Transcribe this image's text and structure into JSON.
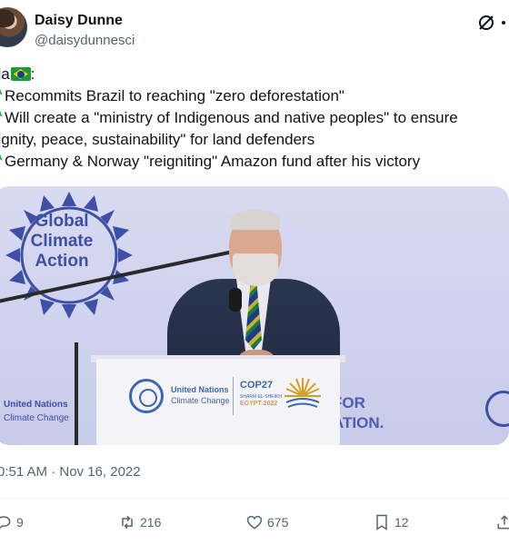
{
  "author": {
    "display_name": "Daisy Dunne",
    "handle": "@daisydunnesci"
  },
  "tweet": {
    "line1_prefix": "ula",
    "line2": "Recommits Brazil to reaching \"zero deforestation\"",
    "line3": "Will create a \"ministry of Indigenous and native peoples\" to ensure",
    "line4": "dignity, peace, sustainability\" for land defenders",
    "line5": "Germany & Norway \"reigniting\" Amazon fund after his victory"
  },
  "media": {
    "emblem_text": "Global Climate Action",
    "left_org": "United Nations",
    "left_org_sub": "Climate Change",
    "podium_org": "United Nations",
    "podium_org_sub": "Climate Change",
    "cop_title": "COP27",
    "cop_place": "SHARM EL-SHEIKH",
    "cop_country": "EGYPT 2022",
    "right_text_1": "FOR",
    "right_text_2": "ATION."
  },
  "timestamp": "0:51 AM · Nov 16, 2022",
  "actions": {
    "reply_count": "9",
    "retweet_count": "216",
    "like_count": "675",
    "bookmark_count": "12"
  },
  "icons": {
    "grok": "grok-icon",
    "more": "more-icon",
    "reply": "reply-icon",
    "retweet": "retweet-icon",
    "like": "heart-icon",
    "bookmark": "bookmark-icon",
    "share": "share-icon",
    "palm": "palm-tree-emoji",
    "flag": "brazil-flag-emoji"
  },
  "colors": {
    "text_primary": "#0f1419",
    "text_secondary": "#536471",
    "brand_blue": "#3d4fa6"
  }
}
